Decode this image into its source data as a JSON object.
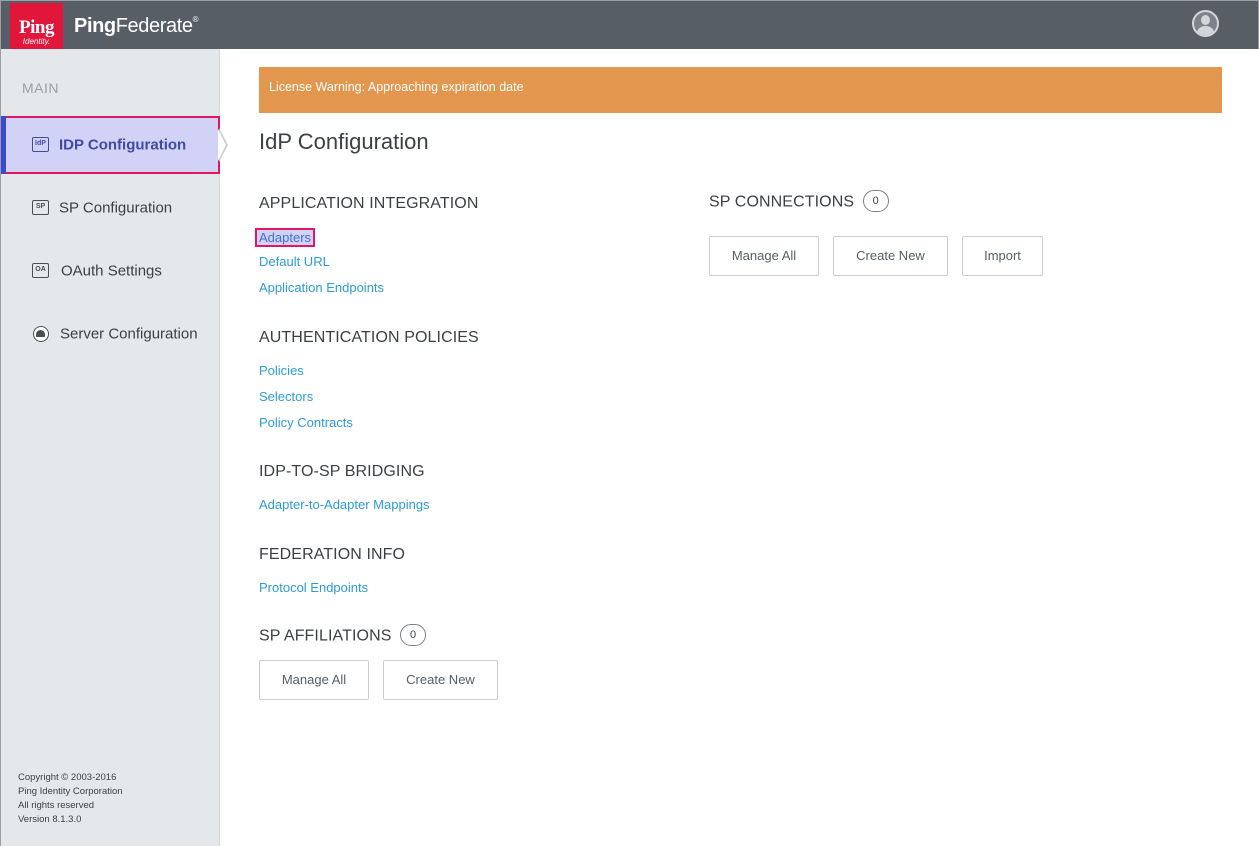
{
  "header": {
    "logo_top": "Ping",
    "logo_bottom": "Identity.",
    "product_bold": "Ping",
    "product_rest": "Federate",
    "product_mark": "®"
  },
  "sidebar": {
    "heading": "MAIN",
    "items": [
      {
        "label": "IDP Configuration",
        "icon": "idp-icon",
        "icon_text": "IdP",
        "active": true
      },
      {
        "label": "SP Configuration",
        "icon": "sp-icon",
        "icon_text": "SP",
        "active": false
      },
      {
        "label": "OAuth Settings",
        "icon": "oauth-icon",
        "icon_text": "OA",
        "active": false
      },
      {
        "label": "Server Configuration",
        "icon": "server-icon",
        "icon_text": "",
        "active": false
      }
    ],
    "footer": {
      "copyright": "Copyright © 2003-2016",
      "company": "Ping Identity Corporation",
      "rights": "All rights reserved",
      "version": "Version 8.1.3.0"
    }
  },
  "main": {
    "license_warning": "License Warning: Approaching expiration date",
    "title": "IdP Configuration",
    "application_integration": {
      "heading": "APPLICATION INTEGRATION",
      "links": [
        "Adapters",
        "Default URL",
        "Application Endpoints"
      ]
    },
    "authentication_policies": {
      "heading": "AUTHENTICATION POLICIES",
      "links": [
        "Policies",
        "Selectors",
        "Policy Contracts"
      ]
    },
    "bridging": {
      "heading": "IDP-TO-SP BRIDGING",
      "links": [
        "Adapter-to-Adapter Mappings"
      ]
    },
    "federation_info": {
      "heading": "FEDERATION INFO",
      "links": [
        "Protocol Endpoints"
      ]
    },
    "sp_affiliations": {
      "heading": "SP AFFILIATIONS",
      "count": "0",
      "buttons": [
        "Manage All",
        "Create New"
      ]
    },
    "sp_connections": {
      "heading": "SP CONNECTIONS",
      "count": "0",
      "buttons": [
        "Manage All",
        "Create New",
        "Import"
      ]
    }
  },
  "colors": {
    "header_bg": "#575e66",
    "logo_red": "#e2153a",
    "license_orange": "#e2964e",
    "link_blue": "#2d9bd8",
    "highlight_border": "#e0185f"
  }
}
